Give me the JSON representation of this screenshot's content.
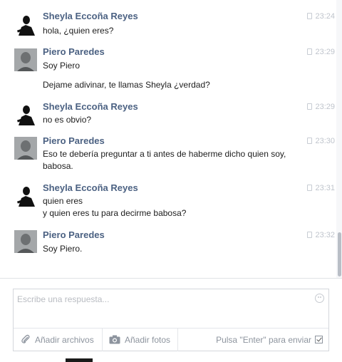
{
  "messages": [
    {
      "sender": "Sheyla Eccoña Reyes",
      "avatar": "silhouette-avatar",
      "time": "23:24",
      "lines": [
        "hola, ¿quien eres?"
      ]
    },
    {
      "sender": "Piero Paredes",
      "avatar": "photo-avatar",
      "time": "23:29",
      "lines": [
        "Soy Piero",
        "Dejame adivinar, te llamas Sheyla ¿verdad?"
      ]
    },
    {
      "sender": "Sheyla Eccoña Reyes",
      "avatar": "silhouette-avatar",
      "time": "23:29",
      "lines": [
        "no es obvio?"
      ]
    },
    {
      "sender": "Piero Paredes",
      "avatar": "photo-avatar",
      "time": "23:30",
      "lines": [
        "Eso te debería preguntar a ti antes de haberme dicho quien soy,",
        "babosa."
      ]
    },
    {
      "sender": "Sheyla Eccoña Reyes",
      "avatar": "silhouette-avatar",
      "time": "23:31",
      "lines": [
        "quien eres",
        "y quien eres tu para decirme babosa?"
      ]
    },
    {
      "sender": "Piero Paredes",
      "avatar": "photo-avatar",
      "time": "23:32",
      "lines": [
        "Soy Piero."
      ]
    }
  ],
  "composer": {
    "placeholder": "Escribe una respuesta...",
    "attach_label": "Añadir archivos",
    "photo_label": "Añadir fotos",
    "enter_label": "Pulsa \"Enter\" para enviar",
    "enter_to_send": true
  },
  "colors": {
    "name": "#4b6182",
    "text": "#1d1d1d",
    "meta": "#bfc4cc"
  }
}
